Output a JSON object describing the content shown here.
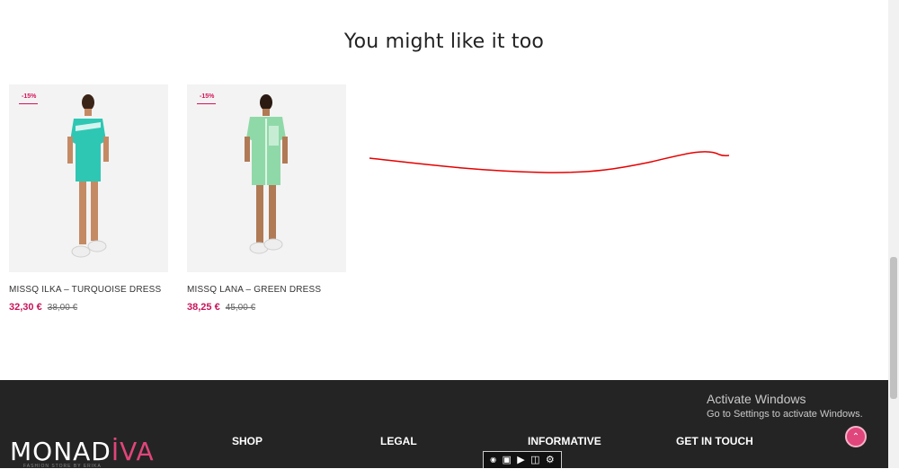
{
  "section": {
    "title": "You might like it too"
  },
  "products": [
    {
      "name": "MISSQ ILKA – TURQUOISE DRESS",
      "price": "32,30 €",
      "old_price": "38,00 €",
      "badge": "-15%",
      "color": "#2ec7b4"
    },
    {
      "name": "MISSQ LANA – GREEN DRESS",
      "price": "38,25 €",
      "old_price": "45,00 €",
      "badge": "-15%",
      "color": "#8fd9a8"
    }
  ],
  "footer": {
    "logo_left": "MONAD",
    "logo_i": "İ",
    "logo_right": "VA",
    "logo_tagline": "FASHION STORE BY ERIKA",
    "columns": [
      "SHOP",
      "LEGAL",
      "INFORMATIVE",
      "GET IN TOUCH"
    ],
    "scroll_top_icon": "chevron-up-icon"
  },
  "os_overlay": {
    "activate_title": "Activate Windows",
    "activate_sub": "Go to Settings to activate Windows."
  },
  "capture_toolbar": {
    "icons": [
      "camera-small-icon",
      "camera-icon",
      "video-icon",
      "window-icon",
      "gear-icon"
    ]
  },
  "colors": {
    "accent": "#e0457b",
    "price": "#c8145a",
    "footer_bg": "#242424",
    "annotation": "#e60000"
  }
}
